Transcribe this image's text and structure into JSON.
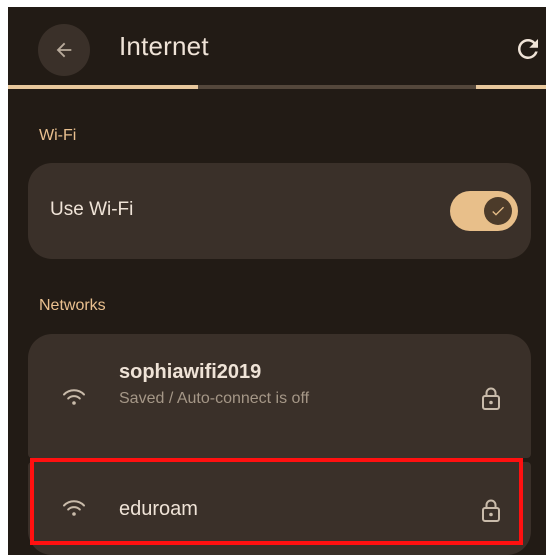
{
  "appbar": {
    "title": "Internet",
    "back_icon": "arrow-back-icon",
    "refresh_icon": "refresh-icon"
  },
  "wifi_section": {
    "label": "Wi-Fi",
    "use_wifi_label": "Use Wi-Fi",
    "use_wifi_on": true
  },
  "networks_section": {
    "label": "Networks",
    "items": [
      {
        "name": "sophiawifi2019",
        "status": "Saved / Auto-connect is off",
        "icon": "wifi-icon",
        "secured_icon": "lock-icon"
      },
      {
        "name": "eduroam",
        "status": "",
        "icon": "wifi-icon",
        "secured_icon": "lock-icon"
      }
    ]
  },
  "colors": {
    "background": "#221b15",
    "card": "#3a3029",
    "accent": "#e8bf8a",
    "section_label": "#eac08f",
    "text_primary": "#efe3d7",
    "text_secondary": "#a59787",
    "highlight": "#ff1010"
  }
}
